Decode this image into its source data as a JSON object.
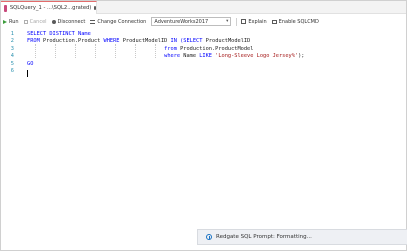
{
  "tab": {
    "title": "SQLQuery_1 - ...\\SQL2...grated)",
    "dirty": true
  },
  "toolbar": {
    "run_label": "Run",
    "cancel_label": "Cancel",
    "disconnect_label": "Disconnect",
    "change_connection_label": "Change Connection",
    "database_value": "AdventureWorks2017",
    "explain_label": "Explain",
    "enable_sqlcmd_label": "Enable SQLCMD"
  },
  "editor": {
    "line_numbers": [
      "1",
      "2",
      "3",
      "4",
      "5",
      "6"
    ],
    "lines": [
      [
        {
          "t": "SELECT DISTINCT Name",
          "c": "kw"
        }
      ],
      [
        {
          "t": "FROM ",
          "c": "kw"
        },
        {
          "t": "Production.Product ",
          "c": ""
        },
        {
          "t": "WHERE ",
          "c": "kw"
        },
        {
          "t": "ProductModelID ",
          "c": ""
        },
        {
          "t": "IN ",
          "c": "kw"
        },
        {
          "t": "(SELECT ",
          "c": "kw"
        },
        {
          "t": "ProductModelID",
          "c": ""
        }
      ],
      [
        {
          "t": "                                           from ",
          "c": "kw"
        },
        {
          "t": "Production.ProductModel",
          "c": ""
        }
      ],
      [
        {
          "t": "                                           where ",
          "c": "kw"
        },
        {
          "t": "Name ",
          "c": ""
        },
        {
          "t": "LIKE ",
          "c": "kw"
        },
        {
          "t": "'Long-Sleeve Logo Jersey%'",
          "c": "str"
        },
        {
          "t": ");",
          "c": ""
        }
      ],
      [
        {
          "t": "GO",
          "c": "kw"
        }
      ],
      [
        {
          "t": "",
          "c": ""
        }
      ]
    ]
  },
  "notification": {
    "text": "Redgate SQL Prompt: Formatting..."
  }
}
